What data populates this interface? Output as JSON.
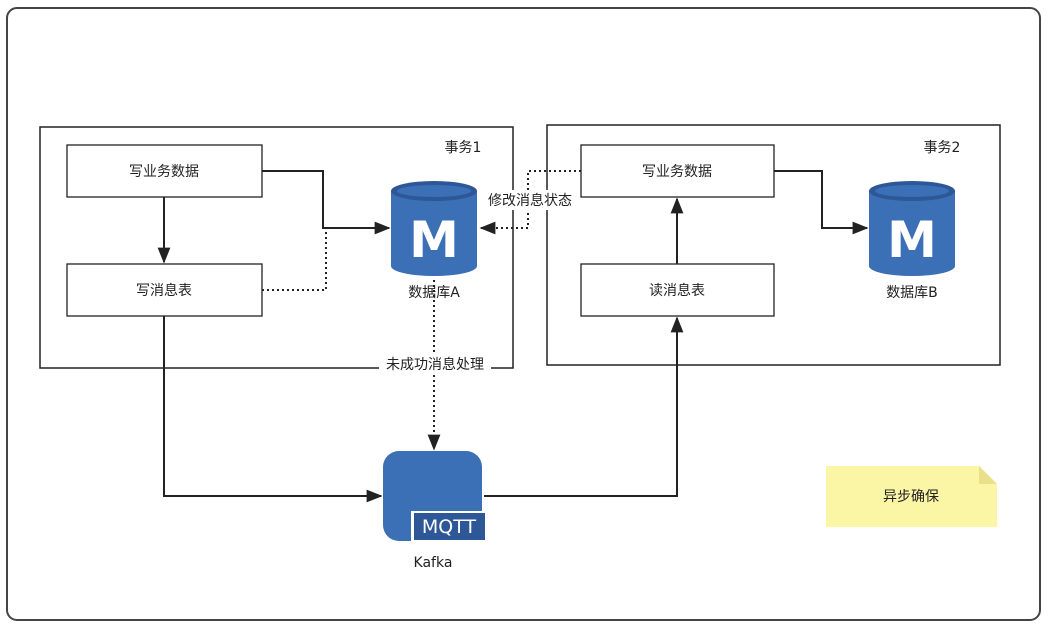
{
  "transaction1": {
    "label": "事务1"
  },
  "transaction2": {
    "label": "事务2"
  },
  "boxes": {
    "write_business_1": "写业务数据",
    "write_message_table": "写消息表",
    "write_business_2": "写业务数据",
    "read_message_table": "读消息表"
  },
  "databases": {
    "db_a": {
      "label": "数据库A",
      "logo": "M"
    },
    "db_b": {
      "label": "数据库B",
      "logo": "M"
    }
  },
  "kafka": {
    "label": "Kafka",
    "badge": "MQTT"
  },
  "edge_labels": {
    "modify_status": "修改消息状态",
    "unsuccessful": "未成功消息处理"
  },
  "note": {
    "text": "异步确保"
  },
  "colors": {
    "db_blue": "#3b6fb6",
    "db_top": "#2d5797",
    "note_yellow": "#fbf5a6",
    "note_fold": "#e9e08a",
    "frame_border": "#444444",
    "line": "#222222"
  }
}
